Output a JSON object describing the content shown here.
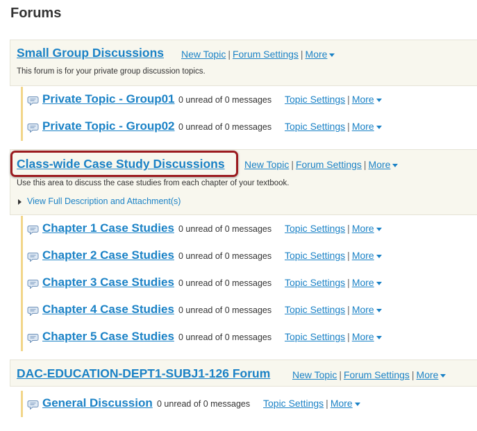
{
  "page": {
    "title": "Forums"
  },
  "icons": {
    "topic": "chat-bubble-icon",
    "more_caret": "caret-down-icon",
    "expand": "triangle-right-icon"
  },
  "colors": {
    "link": "#1b82c6",
    "header_bg": "#f8f7ee",
    "topic_bar": "#f2d68a",
    "highlight": "#9b1b1f"
  },
  "forums": [
    {
      "title": "Small Group Discussions",
      "new_topic": "New Topic",
      "forum_settings": "Forum Settings",
      "more": "More",
      "description": "This forum is for your private group discussion topics.",
      "topics": [
        {
          "title": "Private Topic - Group01",
          "unread": "0 unread of 0 messages",
          "settings": "Topic Settings",
          "more": "More"
        },
        {
          "title": "Private Topic - Group02",
          "unread": "0 unread of 0 messages",
          "settings": "Topic Settings",
          "more": "More"
        }
      ]
    },
    {
      "title": "Class-wide Case Study Discussions",
      "new_topic": "New Topic",
      "forum_settings": "Forum Settings",
      "more": "More",
      "description": "Use this area to discuss the case studies from each chapter of your textbook.",
      "full_description": "View Full Description and Attachment(s)",
      "topics": [
        {
          "title": "Chapter 1 Case Studies",
          "unread": "0 unread of 0 messages",
          "settings": "Topic Settings",
          "more": "More"
        },
        {
          "title": "Chapter 2 Case Studies",
          "unread": "0 unread of 0 messages",
          "settings": "Topic Settings",
          "more": "More"
        },
        {
          "title": "Chapter 3 Case Studies",
          "unread": "0 unread of 0 messages",
          "settings": "Topic Settings",
          "more": "More"
        },
        {
          "title": "Chapter 4 Case Studies",
          "unread": "0 unread of 0 messages",
          "settings": "Topic Settings",
          "more": "More"
        },
        {
          "title": "Chapter 5 Case Studies",
          "unread": "0 unread of 0 messages",
          "settings": "Topic Settings",
          "more": "More"
        }
      ]
    },
    {
      "title": "DAC-EDUCATION-DEPT1-SUBJ1-126 Forum",
      "new_topic": "New Topic",
      "forum_settings": "Forum Settings",
      "more": "More",
      "topics": [
        {
          "title": "General Discussion",
          "unread": "0 unread of 0 messages",
          "settings": "Topic Settings",
          "more": "More"
        }
      ]
    }
  ]
}
